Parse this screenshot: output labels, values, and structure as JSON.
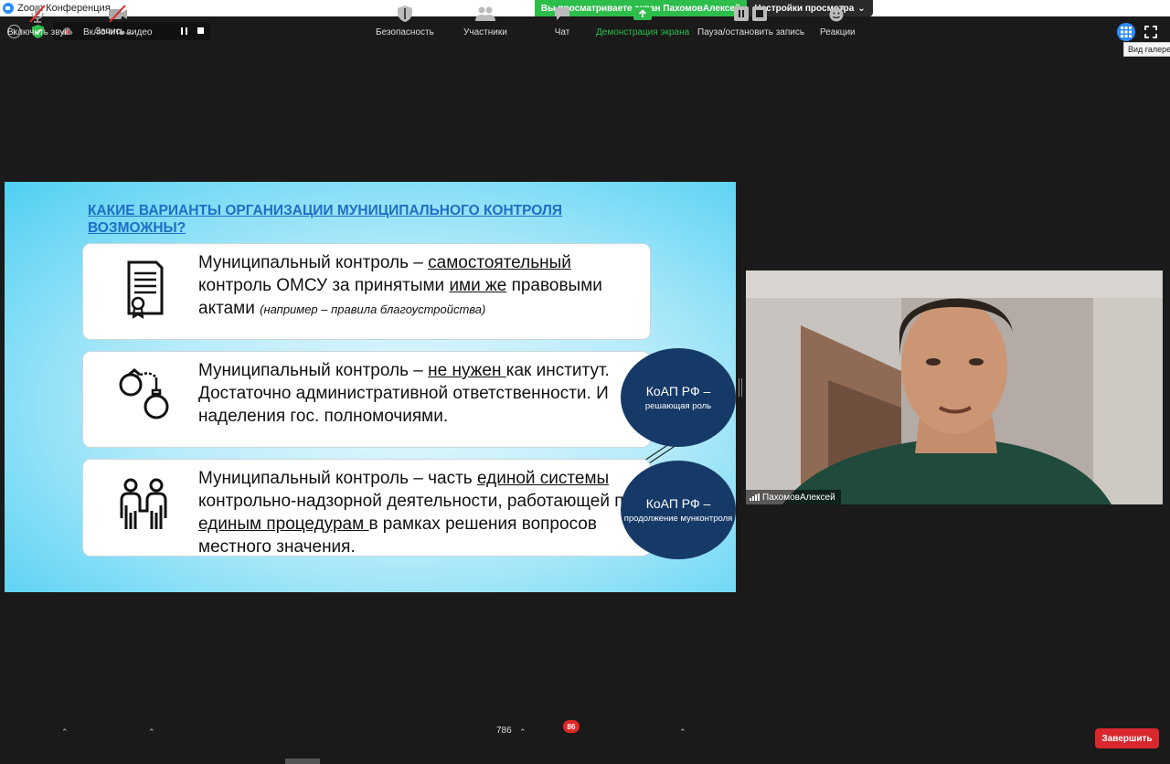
{
  "titlebar": {
    "title": "Zoom Конференция"
  },
  "banner": {
    "viewing_text": "Вы просматриваете экран ПахомовАлексей",
    "view_settings_label": "Настройки просмотра"
  },
  "meeting": {
    "info_icon": "i",
    "recording_label": "Запись..."
  },
  "top_right": {
    "gallery_tooltip": "Вид галереи"
  },
  "slide": {
    "title": "КАКИЕ ВАРИАНТЫ ОРГАНИЗАЦИИ МУНИЦИПАЛЬНОГО КОНТРОЛЯ ВОЗМОЖНЫ?",
    "card1": {
      "a": "Муниципальный контроль – ",
      "b": "самостоятельный",
      "c": " контроль ОМСУ за принятыми ",
      "d": "ими же",
      "e": " правовыми актами ",
      "note": "(например – правила благоустройства)"
    },
    "card2": {
      "a": " Муниципальный контроль – ",
      "b": "не нужен ",
      "c": "как институт. Достаточно административной ответственности. И наделения гос. полномочиями."
    },
    "card3": {
      "a": "Муниципальный контроль – часть ",
      "b": "единой системы",
      "c": " контрольно-надзорной деятельности, работающей по ",
      "d": "единым процедурам ",
      "e": "в рамках решения вопросов местного значения."
    },
    "oval1": {
      "main": "КоАП РФ –",
      "sub": "решающая роль"
    },
    "oval2": {
      "main": "КоАП РФ –",
      "sub": "продолжение мунконтроля"
    }
  },
  "video": {
    "participant_name": "ПахомовАлексей"
  },
  "toolbar": {
    "mute_label": "Включить звук",
    "video_label": "Включить видео",
    "security_label": "Безопасность",
    "participants_label": "Участники",
    "participants_count": "786",
    "chat_label": "Чат",
    "chat_badge": "86",
    "share_label": "Демонстрация экрана",
    "record_label": "Пауза/остановить запись",
    "reactions_label": "Реакции",
    "end_label": "Завершить"
  },
  "colors": {
    "accent_green": "#2dbd4b",
    "zoom_blue": "#2d8cff",
    "end_red": "#d9272e",
    "slide_title_blue": "#1e6fc4",
    "oval_navy": "#163a68"
  }
}
